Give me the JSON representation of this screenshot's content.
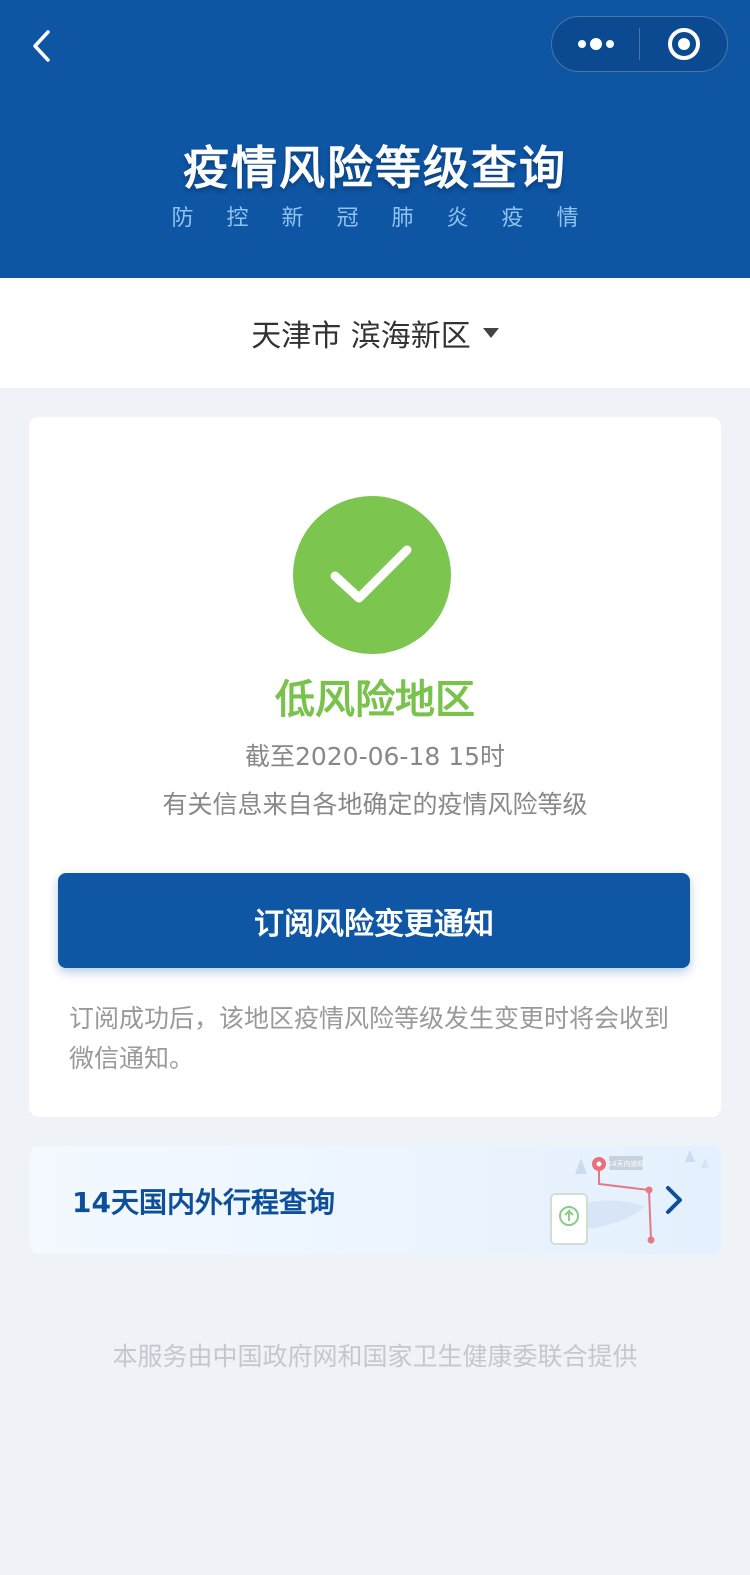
{
  "header": {
    "title": "疫情风险等级查询",
    "subtitle": "防控新冠肺炎疫情",
    "back_icon": "chevron-left-icon",
    "more_icon": "more-dots-icon",
    "close_icon": "target-circle-icon",
    "bg_color": "#0e55a4"
  },
  "region": {
    "label": "天津市 滨海新区"
  },
  "risk_card": {
    "level": "低风险地区",
    "level_color": "#79c24c",
    "status_icon": "checkmark-icon",
    "update_time": "截至2020-06-18 15时",
    "info_source": "有关信息来自各地确定的疫情风险等级",
    "subscribe_button": "订阅风险变更通知",
    "subscribe_note": "订阅成功后，该地区疫情风险等级发生变更时将会收到微信通知。"
  },
  "itinerary": {
    "label": "14天国内外行程查询",
    "illustration_tag": "14天内途经",
    "arrow_icon": "chevron-right-icon"
  },
  "footer": {
    "text": "本服务由中国政府网和国家卫生健康委联合提供"
  }
}
